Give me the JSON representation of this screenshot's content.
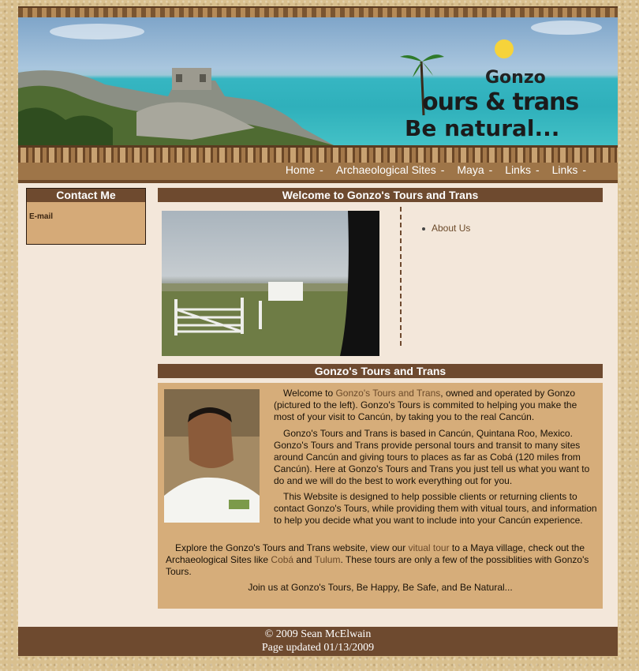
{
  "banner": {
    "logo_line1": "Gonzo",
    "logo_line2": "ours & trans",
    "logo_line3": "Be natural..."
  },
  "nav": {
    "items": [
      {
        "label": "Home",
        "sep": "-"
      },
      {
        "label": "Archaeological Sites",
        "sep": "-"
      },
      {
        "label": "Maya",
        "sep": "-"
      },
      {
        "label": "Links",
        "sep": "-"
      },
      {
        "label": "Links",
        "sep": "-"
      }
    ]
  },
  "sidebar": {
    "contact_title": "Contact Me",
    "email_label": "E-mail"
  },
  "welcome": {
    "title": "Welcome to Gonzo's Tours and Trans",
    "links": [
      "About Us"
    ]
  },
  "article": {
    "title": "Gonzo's Tours and Trans",
    "p1_pre": "Welcome to ",
    "p1_link": "Gonzo's Tours and Trans",
    "p1_post": ", owned and operated by Gonzo (pictured to the left). Gonzo's Tours is commited to helping you make the most of your visit to Cancún, by taking you to the real Cancún.",
    "p2": "Gonzo's Tours and Trans is based in Cancún, Quintana Roo, Mexico. Gonzo's Tours and Trans provide personal tours and transit to many sites around Cancún and giving tours to places as far as Cobá (120 miles from Cancún). Here at Gonzo's Tours and Trans you just tell us what you want to do and we will do the best to work everything out for you.",
    "p3": "This Website is designed to help possible clients or returning clients to contact Gonzo's Tours, while providing them with vitual tours, and information to help you decide what you want to include into your Cancún experience.",
    "p4_a": "Explore the Gonzo's Tours and Trans website, view our ",
    "p4_link1": "vitual tour",
    "p4_b": " to a Maya village, check out the Archaeological Sites like ",
    "p4_link2": "Cobá",
    "p4_c": " and ",
    "p4_link3": "Tulum",
    "p4_d": ". These tours are only a few of the possiblities with Gonzo's Tours.",
    "p5": "Join us at Gonzo's Tours, Be Happy, Be Safe, and Be Natural..."
  },
  "footer": {
    "copyright": "© 2009 Sean McElwain",
    "updated": "Page updated 01/13/2009"
  }
}
